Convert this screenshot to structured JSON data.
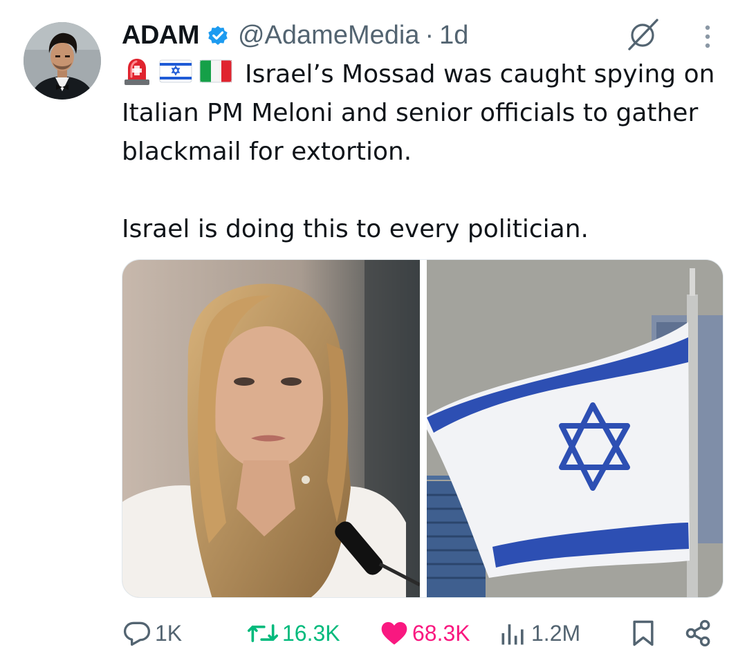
{
  "author": {
    "display_name": "ADAM",
    "handle": "@AdameMedia",
    "separator": "·",
    "time": "1d",
    "verified": true,
    "avatar_icon": "profile-photo-man-in-tuxedo"
  },
  "header_icons": {
    "grok": "grok-icon",
    "more": "more-vertical-icon"
  },
  "tweet": {
    "emojis": [
      "police-light-emoji",
      "israel-flag-emoji",
      "italy-flag-emoji"
    ],
    "line1": "Israel’s Mossad was caught spying on Italian PM Meloni and senior officials to gather blackmail for extortion.",
    "line2": "Israel is doing this to every politician."
  },
  "media": [
    {
      "icon": "photo-woman-politician-at-microphone"
    },
    {
      "icon": "photo-israeli-flag-on-pole"
    }
  ],
  "actions": {
    "replies": "1K",
    "retweets": "16.3K",
    "likes": "68.3K",
    "views": "1.2M"
  },
  "colors": {
    "text": "#0f1419",
    "secondary": "#536471",
    "verified_blue": "#1d9bf0",
    "retweet_green": "#00ba7c",
    "like_pink": "#f91880"
  }
}
